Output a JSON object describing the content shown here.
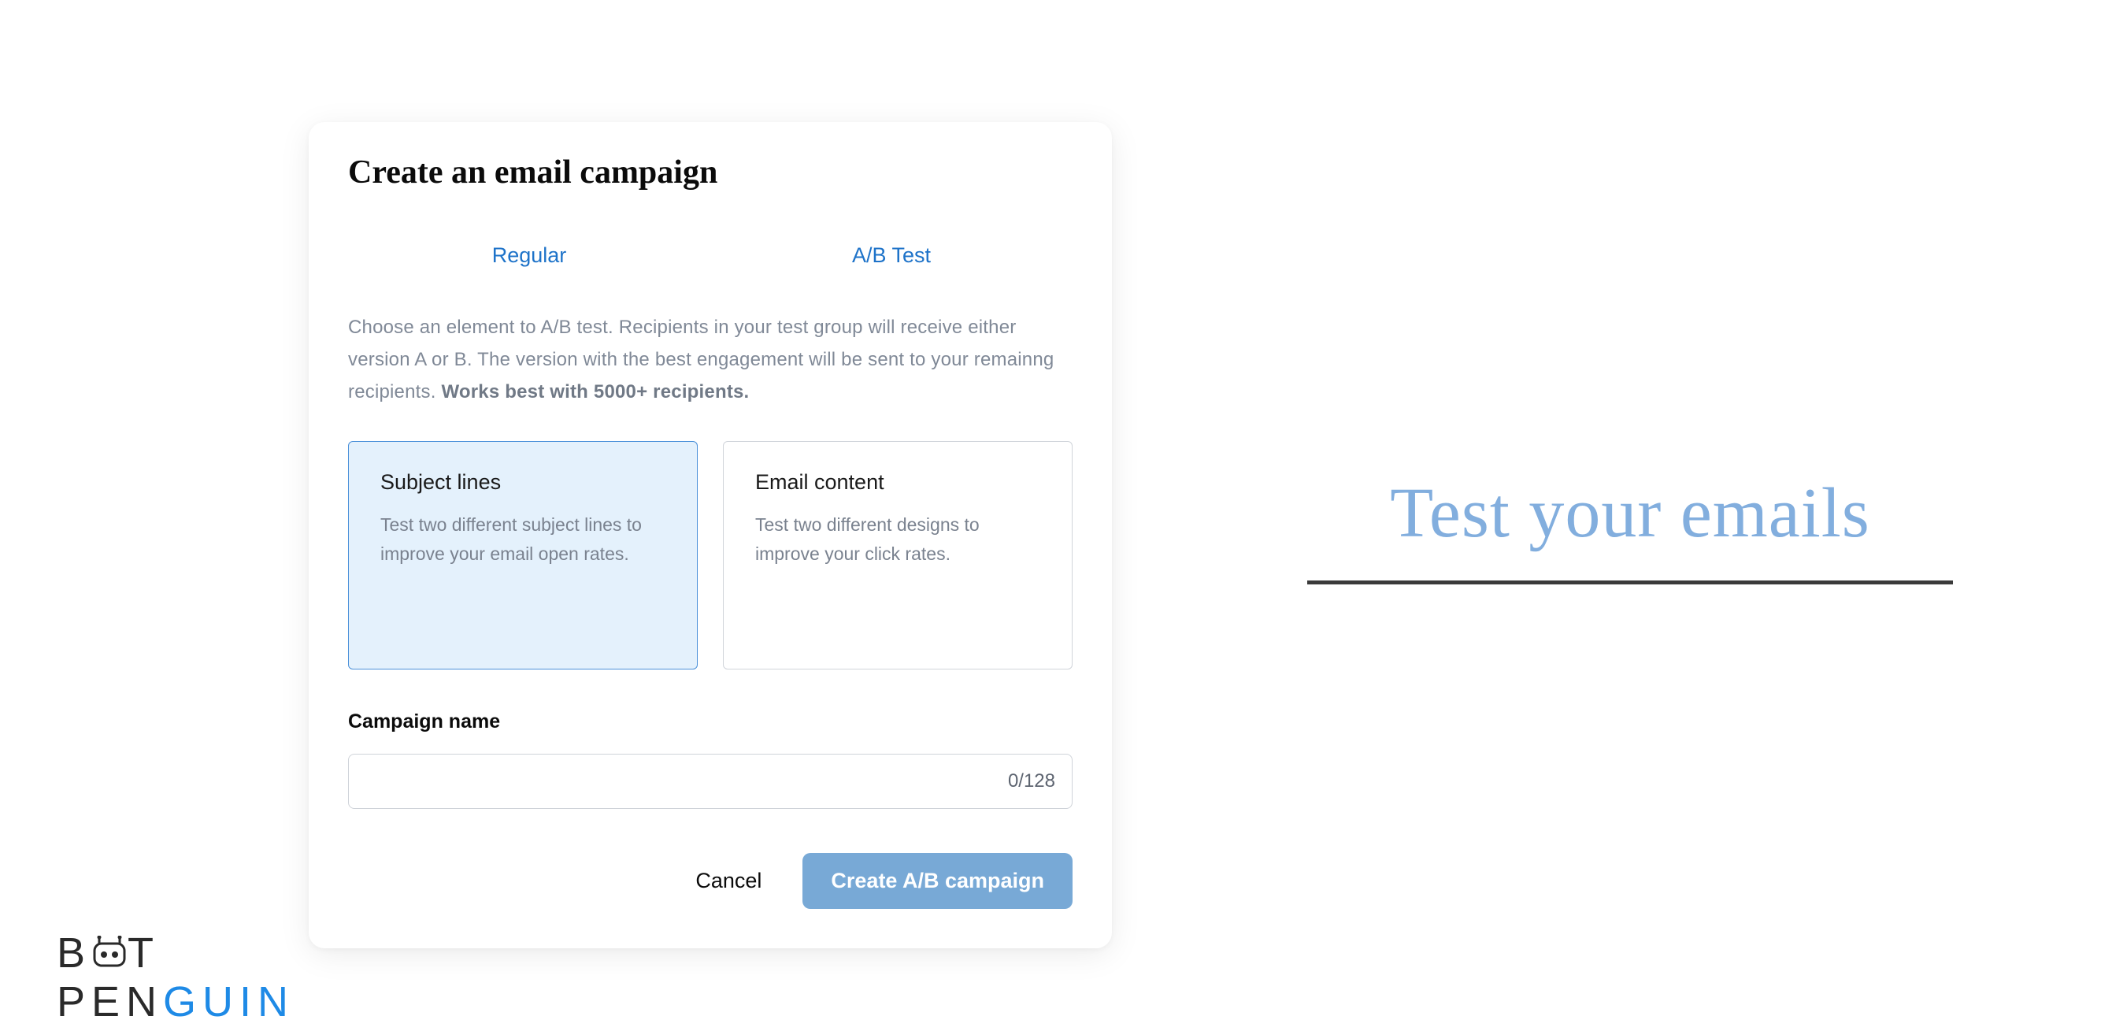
{
  "dialog": {
    "title": "Create an email campaign",
    "tabs": {
      "regular": "Regular",
      "abtest": "A/B Test"
    },
    "description_prefix": "Choose an element to A/B test. Recipients in your test group will receive either version A or B. The version with the best engagement will be sent to your remainng recipients. ",
    "description_bold": "Works best with 5000+ recipients.",
    "options": {
      "subject": {
        "title": "Subject lines",
        "desc": "Test two different subject lines to improve your email open rates."
      },
      "content": {
        "title": "Email content",
        "desc": "Test two different designs to improve your click rates."
      }
    },
    "campaign_label": "Campaign name",
    "campaign_value": "",
    "counter": "0/128",
    "cancel": "Cancel",
    "create": "Create A/B campaign"
  },
  "hero": "Test your emails",
  "logo": {
    "line1a": "B",
    "line1b": "T",
    "line2a": "PEN",
    "line2b": "GUIN"
  }
}
